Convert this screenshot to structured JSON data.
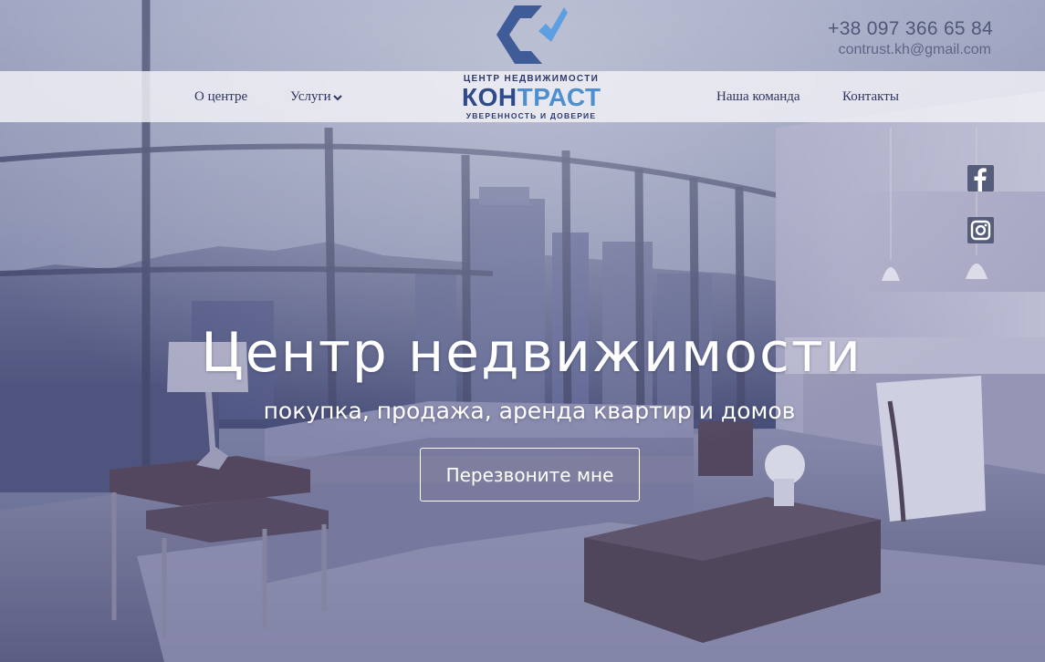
{
  "header": {
    "phone": "+38 097 366 65 84",
    "email": "contrust.kh@gmail.com"
  },
  "logo": {
    "top_line": "ЦЕНТР НЕДВИЖИМОСТИ",
    "name_part1": "КОН",
    "name_part2": "ТРАСТ",
    "tagline": "УВЕРЕННОСТЬ И ДОВЕРИЕ"
  },
  "nav": {
    "about": "О центре",
    "services": "Услуги",
    "team": "Наша команда",
    "contacts": "Контакты"
  },
  "hero": {
    "title": "Центр недвижимости",
    "subtitle": "покупка, продажа, аренда квартир и домов",
    "cta_label": "Перезвоните мне"
  },
  "social": [
    "facebook-icon",
    "instagram-icon"
  ],
  "colors": {
    "navbar_bg": "#f2f2f6",
    "nav_text": "#2d3560",
    "logo_dark": "#2f4a8a",
    "logo_light": "#4e8fd0",
    "hero_overlay": "#6a6f9a",
    "social_bg": "#555d7a"
  }
}
